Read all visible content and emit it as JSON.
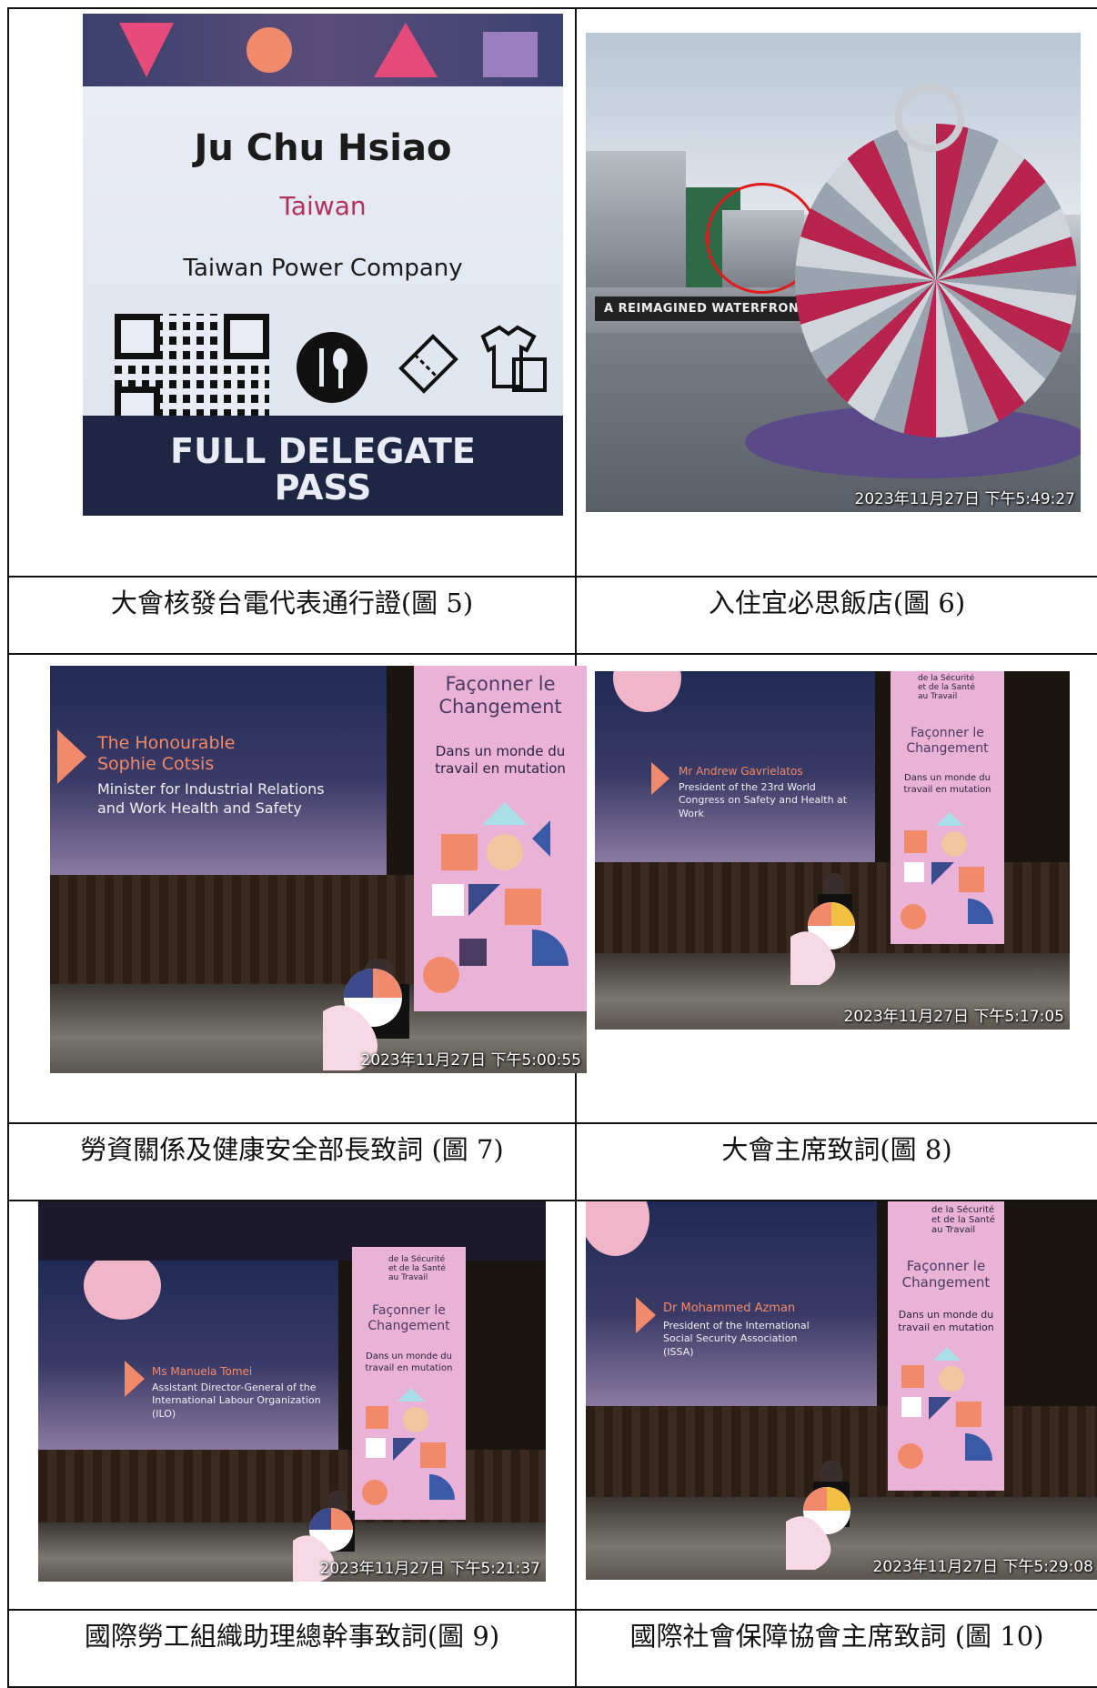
{
  "captions": [
    "大會核發台電代表通行證(圖 5)",
    "入住宜必思飯店(圖 6)",
    "勞資關係及健康安全部長致詞 (圖 7)",
    "大會主席致詞(圖 8)",
    "國際勞工組織助理總幹事致詞(圖 9)",
    "國際社會保障協會主席致詞 (圖 10)"
  ],
  "badge": {
    "name": "Ju Chu Hsiao",
    "country": "Taiwan",
    "organization": "Taiwan Power Company",
    "pass_line1": "FULL DELEGATE",
    "pass_line2": "PASS"
  },
  "harbour": {
    "banner": "A REIMAGINED WATERFRONT",
    "timestamp": "2023年11月27日 下午5:49:27"
  },
  "stage_common": {
    "banner_title_l1": "Façonner le",
    "banner_title_l2": "Changement",
    "banner_sub_l1": "Dans un monde du",
    "banner_sub_l2": "travail en mutation",
    "congress_l1": "de la Sécurité",
    "congress_l2": "et de la Santé",
    "congress_l3": "au Travail"
  },
  "photo7": {
    "name_l1": "The Honourable",
    "name_l2": "Sophie Cotsis",
    "role_l1": "Minister for Industrial Relations",
    "role_l2": "and Work Health and Safety",
    "timestamp": "2023年11月27日 下午5:00:55"
  },
  "photo8": {
    "name": "Mr Andrew Gavrielatos",
    "role_l1": "President of the 23rd World",
    "role_l2": "Congress on Safety and Health at",
    "role_l3": "Work",
    "timestamp": "2023年11月27日 下午5:17:05"
  },
  "photo9": {
    "name": "Ms Manuela Tomei",
    "role_l1": "Assistant Director-General of the",
    "role_l2": "International Labour Organization",
    "role_l3": "(ILO)",
    "timestamp": "2023年11月27日 下午5:21:37"
  },
  "photo10": {
    "name": "Dr Mohammed Azman",
    "role_l1": "President of the International",
    "role_l2": "Social Security Association",
    "role_l3": "(ISSA)",
    "timestamp": "2023年11月27日 下午5:29:08"
  },
  "colors": {
    "banner_pink": "#ebb2d8",
    "accent_orange": "#f08a6a",
    "border": "#111111"
  },
  "icons": [
    "qr-code-icon",
    "cutlery-icon",
    "ticket-icon",
    "tshirt-bag-icon",
    "red-circle-annotation"
  ]
}
